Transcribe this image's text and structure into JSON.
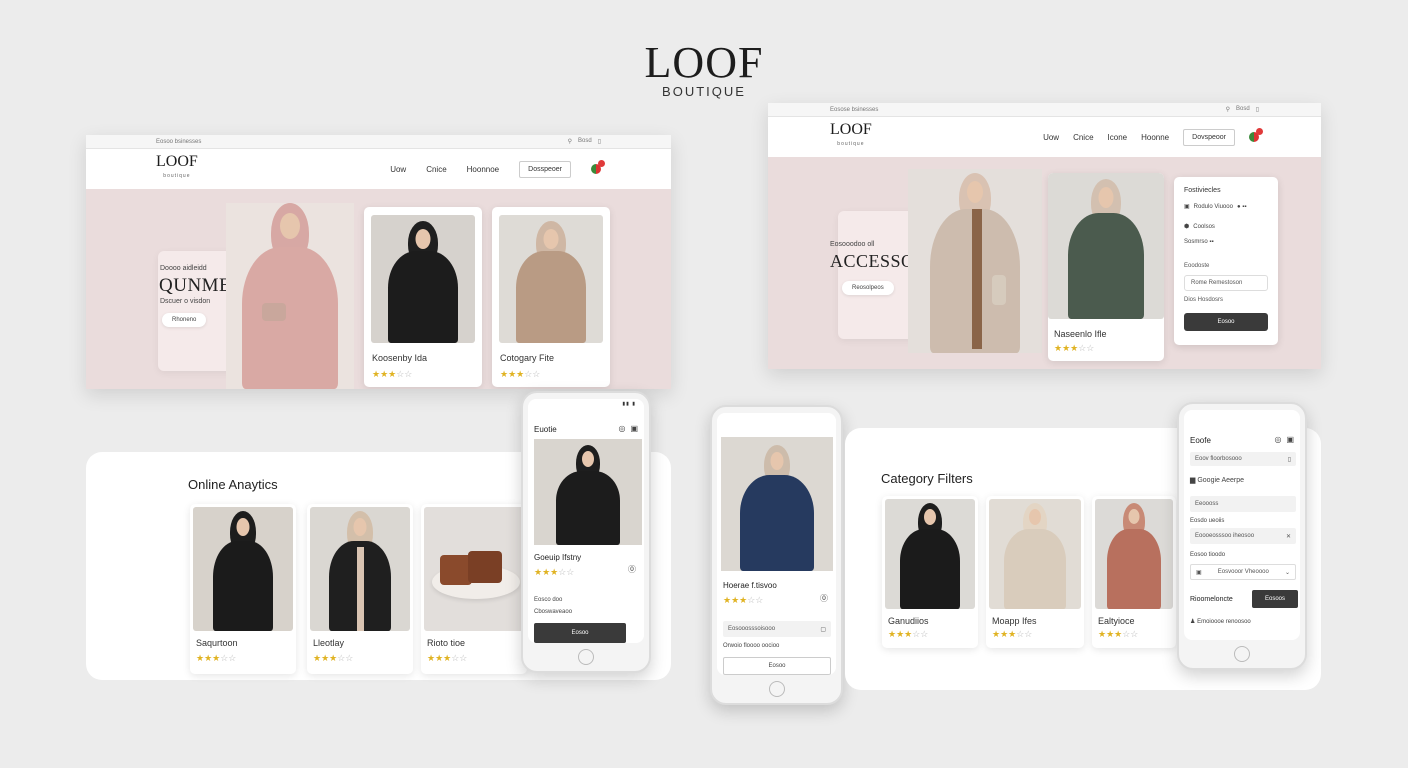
{
  "brand": {
    "logo": "LOOF",
    "sub": "BOUTIQUE"
  },
  "desktop1": {
    "topbar_left": "Eosoo bsinesses",
    "topbar_right": [
      "⚲",
      "Bosd",
      "▯"
    ],
    "logo": "LOOF",
    "logo_sub": "boutique",
    "nav": [
      "Uow",
      "Cnice",
      "Hoonnoe"
    ],
    "nav_button": "Dosspeoer",
    "hero_small": "Doooo aidleidd",
    "hero_title": "QUNMERGY",
    "hero_caption": "Dscuer o visdon",
    "hero_button": "Rhoneno",
    "products": [
      {
        "name": "Koosenby Ida",
        "rating": 3
      },
      {
        "name": "Cotogary Fite",
        "rating": 3
      }
    ]
  },
  "desktop2": {
    "topbar_left": "Eosose bsinesses",
    "topbar_right": [
      "⚲",
      "Bosd",
      "▯"
    ],
    "logo": "LOOF",
    "logo_sub": "boutique",
    "nav": [
      "Uow",
      "Cnice",
      "Icone",
      "Hoonne"
    ],
    "nav_button": "Dovspeoor",
    "hero_small": "Eosooodoo oll",
    "hero_title": "ACCESSORES",
    "hero_button": "Reosolpeos",
    "product": {
      "name": "Naseenlo Ifle",
      "rating": 3
    },
    "filter_panel": {
      "title": "Fostiviecles",
      "row1": "Rodulo Viuooo",
      "row1_badge": "● ▪▪",
      "row2": "Coolsos",
      "row3": "Sosmrso ▪▪",
      "label": "Eoodoste",
      "field": "Rome Remestoson",
      "label2": "Dios Hosdosrs",
      "button": "Eosoo"
    }
  },
  "analytics": {
    "title": "Online Anaytics",
    "cards": [
      {
        "name": "Saqurtoon",
        "rating": 3
      },
      {
        "name": "Lleotlay",
        "rating": 3
      },
      {
        "name": "Rioto tioe",
        "rating": 3
      }
    ]
  },
  "phone1": {
    "title": "Euotie",
    "product": "Goeuip Ifstny",
    "rating": 3,
    "text1": "Eosco doo",
    "text2": "Cboswaveaoo",
    "button": "Eosoo"
  },
  "phone2": {
    "product": "Hoerae f.tisvoo",
    "rating": 3,
    "field": "Eosooosssoisooo",
    "text1": "Orwoio floooo oocioo",
    "button": "Eosoo"
  },
  "filters": {
    "title": "Category Filters",
    "cards": [
      {
        "name": "Ganudiios",
        "rating": 3
      },
      {
        "name": "Moapp Ifes",
        "rating": 3
      },
      {
        "name": "Ealtyioce",
        "rating": 3
      }
    ]
  },
  "phone3": {
    "title": "Eoofe",
    "search": "Eoov floorbosooo",
    "row1": "Googie Aeerpe",
    "field1": "Eeoooss",
    "label2": "Eosdo ueoiis",
    "field2": "Eoooeosssoo iheosoo",
    "label3": "Eosoo tioodo",
    "field3": "Eosvooor Vheoooo",
    "row_label": "Rioomeloncte",
    "row_button": "Eosoos",
    "footer": "Emoioooe renoosoo"
  },
  "colors": {
    "hero": "#eadcdc",
    "star": "#e0b323",
    "dark_button": "#3a3a3a"
  }
}
